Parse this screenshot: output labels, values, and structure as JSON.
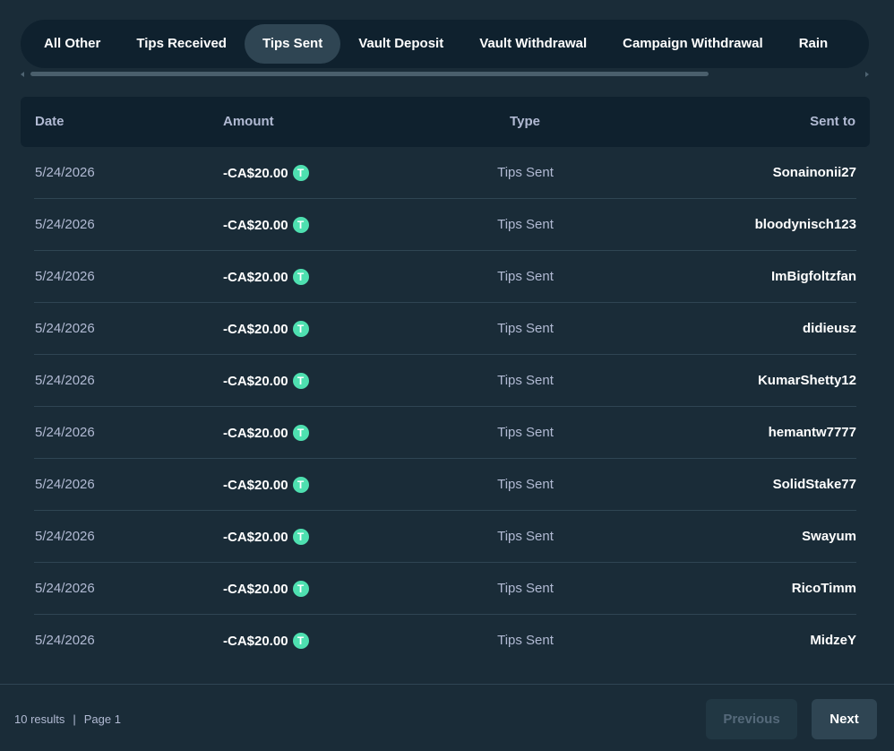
{
  "tabs": [
    {
      "label": "All Other",
      "active": false
    },
    {
      "label": "Tips Received",
      "active": false
    },
    {
      "label": "Tips Sent",
      "active": true
    },
    {
      "label": "Vault Deposit",
      "active": false
    },
    {
      "label": "Vault Withdrawal",
      "active": false
    },
    {
      "label": "Campaign Withdrawal",
      "active": false
    },
    {
      "label": "Rain",
      "active": false
    }
  ],
  "table": {
    "headers": {
      "date": "Date",
      "amount": "Amount",
      "type": "Type",
      "sent_to": "Sent to"
    },
    "rows": [
      {
        "date": "5/24/2026",
        "amount": "-CA$20.00",
        "type": "Tips Sent",
        "sent_to": "Sonainonii27"
      },
      {
        "date": "5/24/2026",
        "amount": "-CA$20.00",
        "type": "Tips Sent",
        "sent_to": "bloodynisch123"
      },
      {
        "date": "5/24/2026",
        "amount": "-CA$20.00",
        "type": "Tips Sent",
        "sent_to": "ImBigfoltzfan"
      },
      {
        "date": "5/24/2026",
        "amount": "-CA$20.00",
        "type": "Tips Sent",
        "sent_to": "didieusz"
      },
      {
        "date": "5/24/2026",
        "amount": "-CA$20.00",
        "type": "Tips Sent",
        "sent_to": "KumarShetty12"
      },
      {
        "date": "5/24/2026",
        "amount": "-CA$20.00",
        "type": "Tips Sent",
        "sent_to": "hemantw7777"
      },
      {
        "date": "5/24/2026",
        "amount": "-CA$20.00",
        "type": "Tips Sent",
        "sent_to": "SolidStake77"
      },
      {
        "date": "5/24/2026",
        "amount": "-CA$20.00",
        "type": "Tips Sent",
        "sent_to": "Swayum"
      },
      {
        "date": "5/24/2026",
        "amount": "-CA$20.00",
        "type": "Tips Sent",
        "sent_to": "RicoTimm"
      },
      {
        "date": "5/24/2026",
        "amount": "-CA$20.00",
        "type": "Tips Sent",
        "sent_to": "MidzeY"
      }
    ],
    "currency_icon": "tether-coin-icon",
    "currency_glyph": "T"
  },
  "footer": {
    "results": "10 results",
    "separator": "|",
    "page": "Page 1",
    "previous_label": "Previous",
    "next_label": "Next"
  },
  "colors": {
    "background": "#1a2c38",
    "panel": "#0f212e",
    "active_tab": "#2f4553",
    "coin": "#4ee0b0"
  }
}
